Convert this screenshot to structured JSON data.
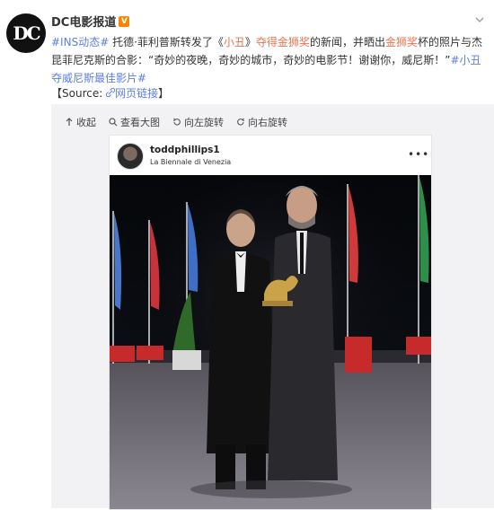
{
  "account": {
    "avatar_text": "DC",
    "name": "DC电影报道"
  },
  "post": {
    "parts": [
      {
        "text": "#INS动态#",
        "kind": "topic"
      },
      {
        "text": " 托德·菲利普斯转发了《",
        "kind": "plain"
      },
      {
        "text": "小丑",
        "kind": "link"
      },
      {
        "text": "》",
        "kind": "plain"
      },
      {
        "text": "夺得金狮奖",
        "kind": "link"
      },
      {
        "text": "的新闻，并晒出",
        "kind": "plain"
      },
      {
        "text": "金狮奖",
        "kind": "link"
      },
      {
        "text": "杯的照片与杰昆菲尼克斯的合影：“奇妙的夜晚，奇妙的城市，奇妙的电影节！谢谢你，威尼斯！”",
        "kind": "plain"
      },
      {
        "text": "#小丑夺威尼斯最佳影片#",
        "kind": "topic"
      }
    ],
    "source_prefix": "【Source: ",
    "source_link": "网页链接",
    "source_suffix": "】"
  },
  "toolbar": {
    "collapse": "收起",
    "view_large": "查看大图",
    "rotate_left": "向左旋转",
    "rotate_right": "向右旋转"
  },
  "embedded_post": {
    "username": "toddphillips1",
    "location": "La Biennale di Venezia",
    "more": "•••"
  },
  "colors": {
    "link": "#eb7350",
    "topic": "#5d7fe0",
    "verified": "#ff8200"
  }
}
